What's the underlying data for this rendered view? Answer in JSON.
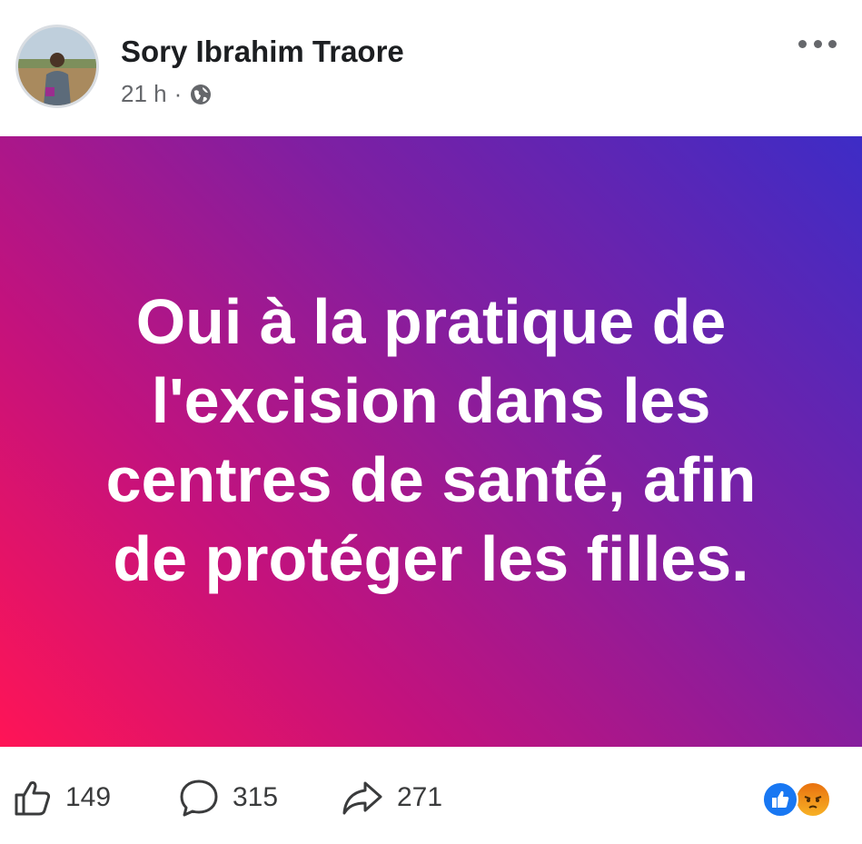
{
  "post": {
    "author": "Sory Ibrahim Traore",
    "time": "21 h",
    "separator": "·",
    "audience_icon": "globe-icon",
    "status_lines": [
      "Oui à la pratique de",
      "l'excision dans les",
      "centres de santé, afin",
      "de protéger les filles."
    ]
  },
  "actions": {
    "likes": "149",
    "comments": "315",
    "shares": "271"
  },
  "reactions": [
    "like-reaction-icon",
    "angry-reaction-icon"
  ],
  "colors": {
    "gradient_start": "#ff1456",
    "gradient_mid": "#7f1fa2",
    "gradient_end": "#3d2cc6",
    "like_blue": "#1877f2",
    "text_dark": "#1c1e21",
    "text_meta": "#65676b"
  }
}
